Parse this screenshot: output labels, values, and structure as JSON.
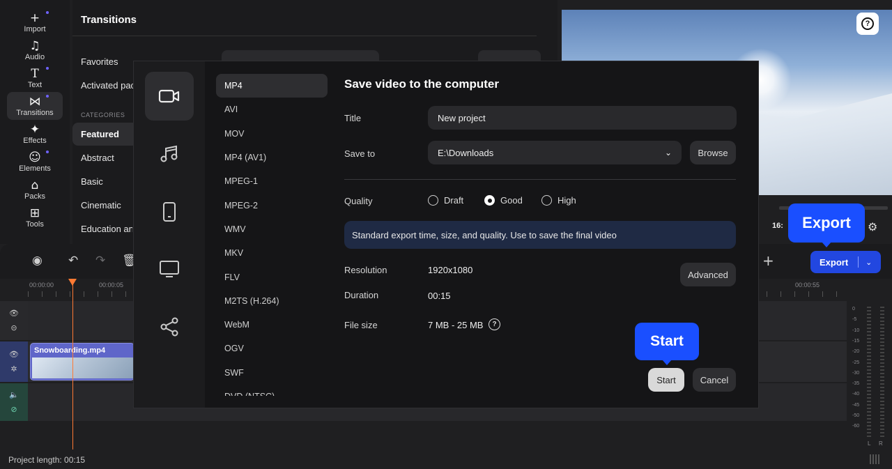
{
  "rail": [
    {
      "label": "Import",
      "icon": "plus-icon",
      "glyph": "+",
      "dot": true
    },
    {
      "label": "Audio",
      "icon": "music-note-icon",
      "glyph": "♫",
      "dot": false
    },
    {
      "label": "Text",
      "icon": "text-icon",
      "glyph": "T",
      "dot": true
    },
    {
      "label": "Transitions",
      "icon": "transitions-icon",
      "glyph": "⋈",
      "dot": true,
      "active": true
    },
    {
      "label": "Effects",
      "icon": "effects-icon",
      "glyph": "✦",
      "dot": false
    },
    {
      "label": "Elements",
      "icon": "elements-icon",
      "glyph": "☺",
      "dot": true
    },
    {
      "label": "Packs",
      "icon": "packs-icon",
      "glyph": "⌂",
      "dot": false
    },
    {
      "label": "Tools",
      "icon": "tools-icon",
      "glyph": "⊞",
      "dot": false
    }
  ],
  "panel": {
    "title": "Transitions",
    "favorites": "Favorites",
    "activated": "Activated pac",
    "categories_label": "CATEGORIES",
    "categories": [
      "Featured",
      "Abstract",
      "Basic",
      "Cinematic",
      "Education and"
    ]
  },
  "preview": {
    "aspect_partial": "16:9",
    "time_partial": "16:"
  },
  "timeline": {
    "ticks": [
      "00:00:00",
      "00:00:05",
      "00:00:55"
    ],
    "clip_name": "Snowboarding.mp4",
    "project_length": "Project length: 00:15",
    "meter_labels": [
      "0",
      "-5",
      "-10",
      "-15",
      "-20",
      "-25",
      "-30",
      "-35",
      "-40",
      "-45",
      "-50",
      "-60"
    ],
    "meter_channels": [
      "L",
      "R"
    ]
  },
  "export": {
    "button_label": "Export",
    "callout_export": "Export",
    "callout_start": "Start",
    "accent": "#2247e0"
  },
  "dialog": {
    "title": "Save video to the computer",
    "formats": [
      "MP4",
      "AVI",
      "MOV",
      "MP4 (AV1)",
      "MPEG-1",
      "MPEG-2",
      "WMV",
      "MKV",
      "FLV",
      "M2TS (H.264)",
      "WebM",
      "OGV",
      "SWF",
      "DVD (NTSC)"
    ],
    "selected_format": "MP4",
    "title_label": "Title",
    "title_value": "New project",
    "save_to_label": "Save to",
    "save_to_value": "E:\\Downloads",
    "browse": "Browse",
    "quality_label": "Quality",
    "quality_options": [
      "Draft",
      "Good",
      "High"
    ],
    "quality_selected": "Good",
    "info": "Standard export time, size, and quality. Use to save the final video",
    "resolution_label": "Resolution",
    "resolution_value": "1920x1080",
    "advanced": "Advanced",
    "duration_label": "Duration",
    "duration_value": "00:15",
    "filesize_label": "File size",
    "filesize_value": "7 MB - 25 MB",
    "start": "Start",
    "cancel": "Cancel"
  }
}
